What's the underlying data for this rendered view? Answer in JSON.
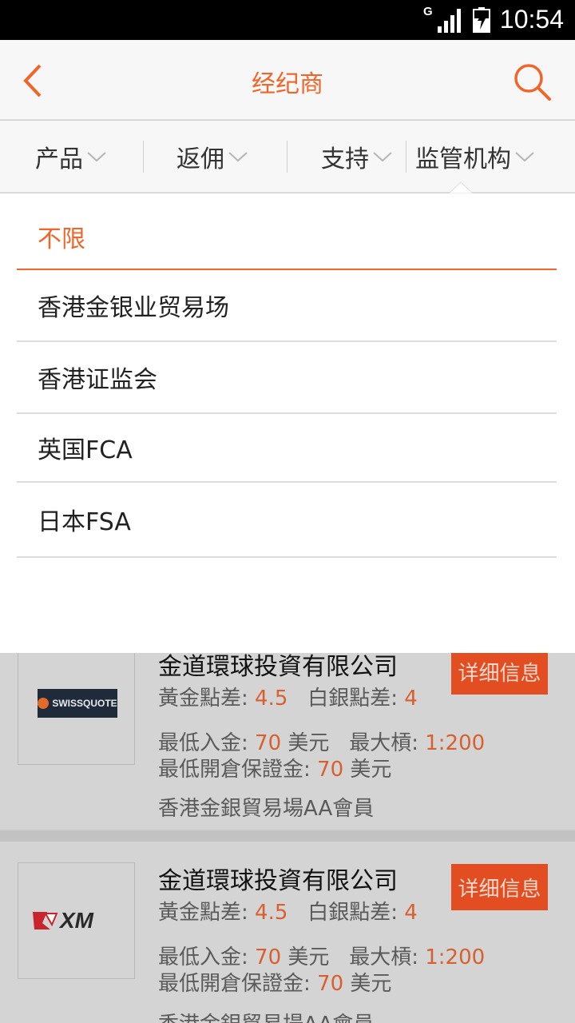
{
  "status_bar": {
    "network": "G",
    "time": "10:54"
  },
  "header": {
    "title": "经纪商",
    "back_icon": "chevron-left-icon",
    "search_icon": "search-icon"
  },
  "filters": [
    {
      "label": "产品"
    },
    {
      "label": "返佣"
    },
    {
      "label": "支持"
    },
    {
      "label": "监管机构"
    }
  ],
  "dropdown": {
    "options": [
      "不限",
      "香港金银业贸易场",
      "香港证监会",
      "英国FCA",
      "日本FSA"
    ],
    "selected_index": 0
  },
  "brokers": [
    {
      "logo_text": "SWISSQUOTE",
      "name": "金道環球投資有限公司",
      "detail_label": "详细信息",
      "gold_spread_label": "黃金點差:",
      "gold_spread": "4.5",
      "silver_spread_label": "白銀點差:",
      "silver_spread": "4",
      "min_deposit_label": "最低入金:",
      "min_deposit": "70",
      "min_deposit_unit": "美元",
      "max_leverage_label": "最大槓:",
      "max_leverage": "1:200",
      "min_margin_label": "最低開倉保證金:",
      "min_margin": "70",
      "min_margin_unit": "美元",
      "membership": "香港金銀貿易場AA會員"
    },
    {
      "logo_text": "XM",
      "name": "金道環球投資有限公司",
      "detail_label": "详细信息",
      "gold_spread_label": "黃金點差:",
      "gold_spread": "4.5",
      "silver_spread_label": "白銀點差:",
      "silver_spread": "4",
      "min_deposit_label": "最低入金:",
      "min_deposit": "70",
      "min_deposit_unit": "美元",
      "max_leverage_label": "最大槓:",
      "max_leverage": "1:200",
      "min_margin_label": "最低開倉保證金:",
      "min_margin": "70",
      "min_margin_unit": "美元",
      "membership": "香港金銀貿易場AA會員"
    }
  ],
  "colors": {
    "accent": "#f06529",
    "button": "#e24e22"
  }
}
